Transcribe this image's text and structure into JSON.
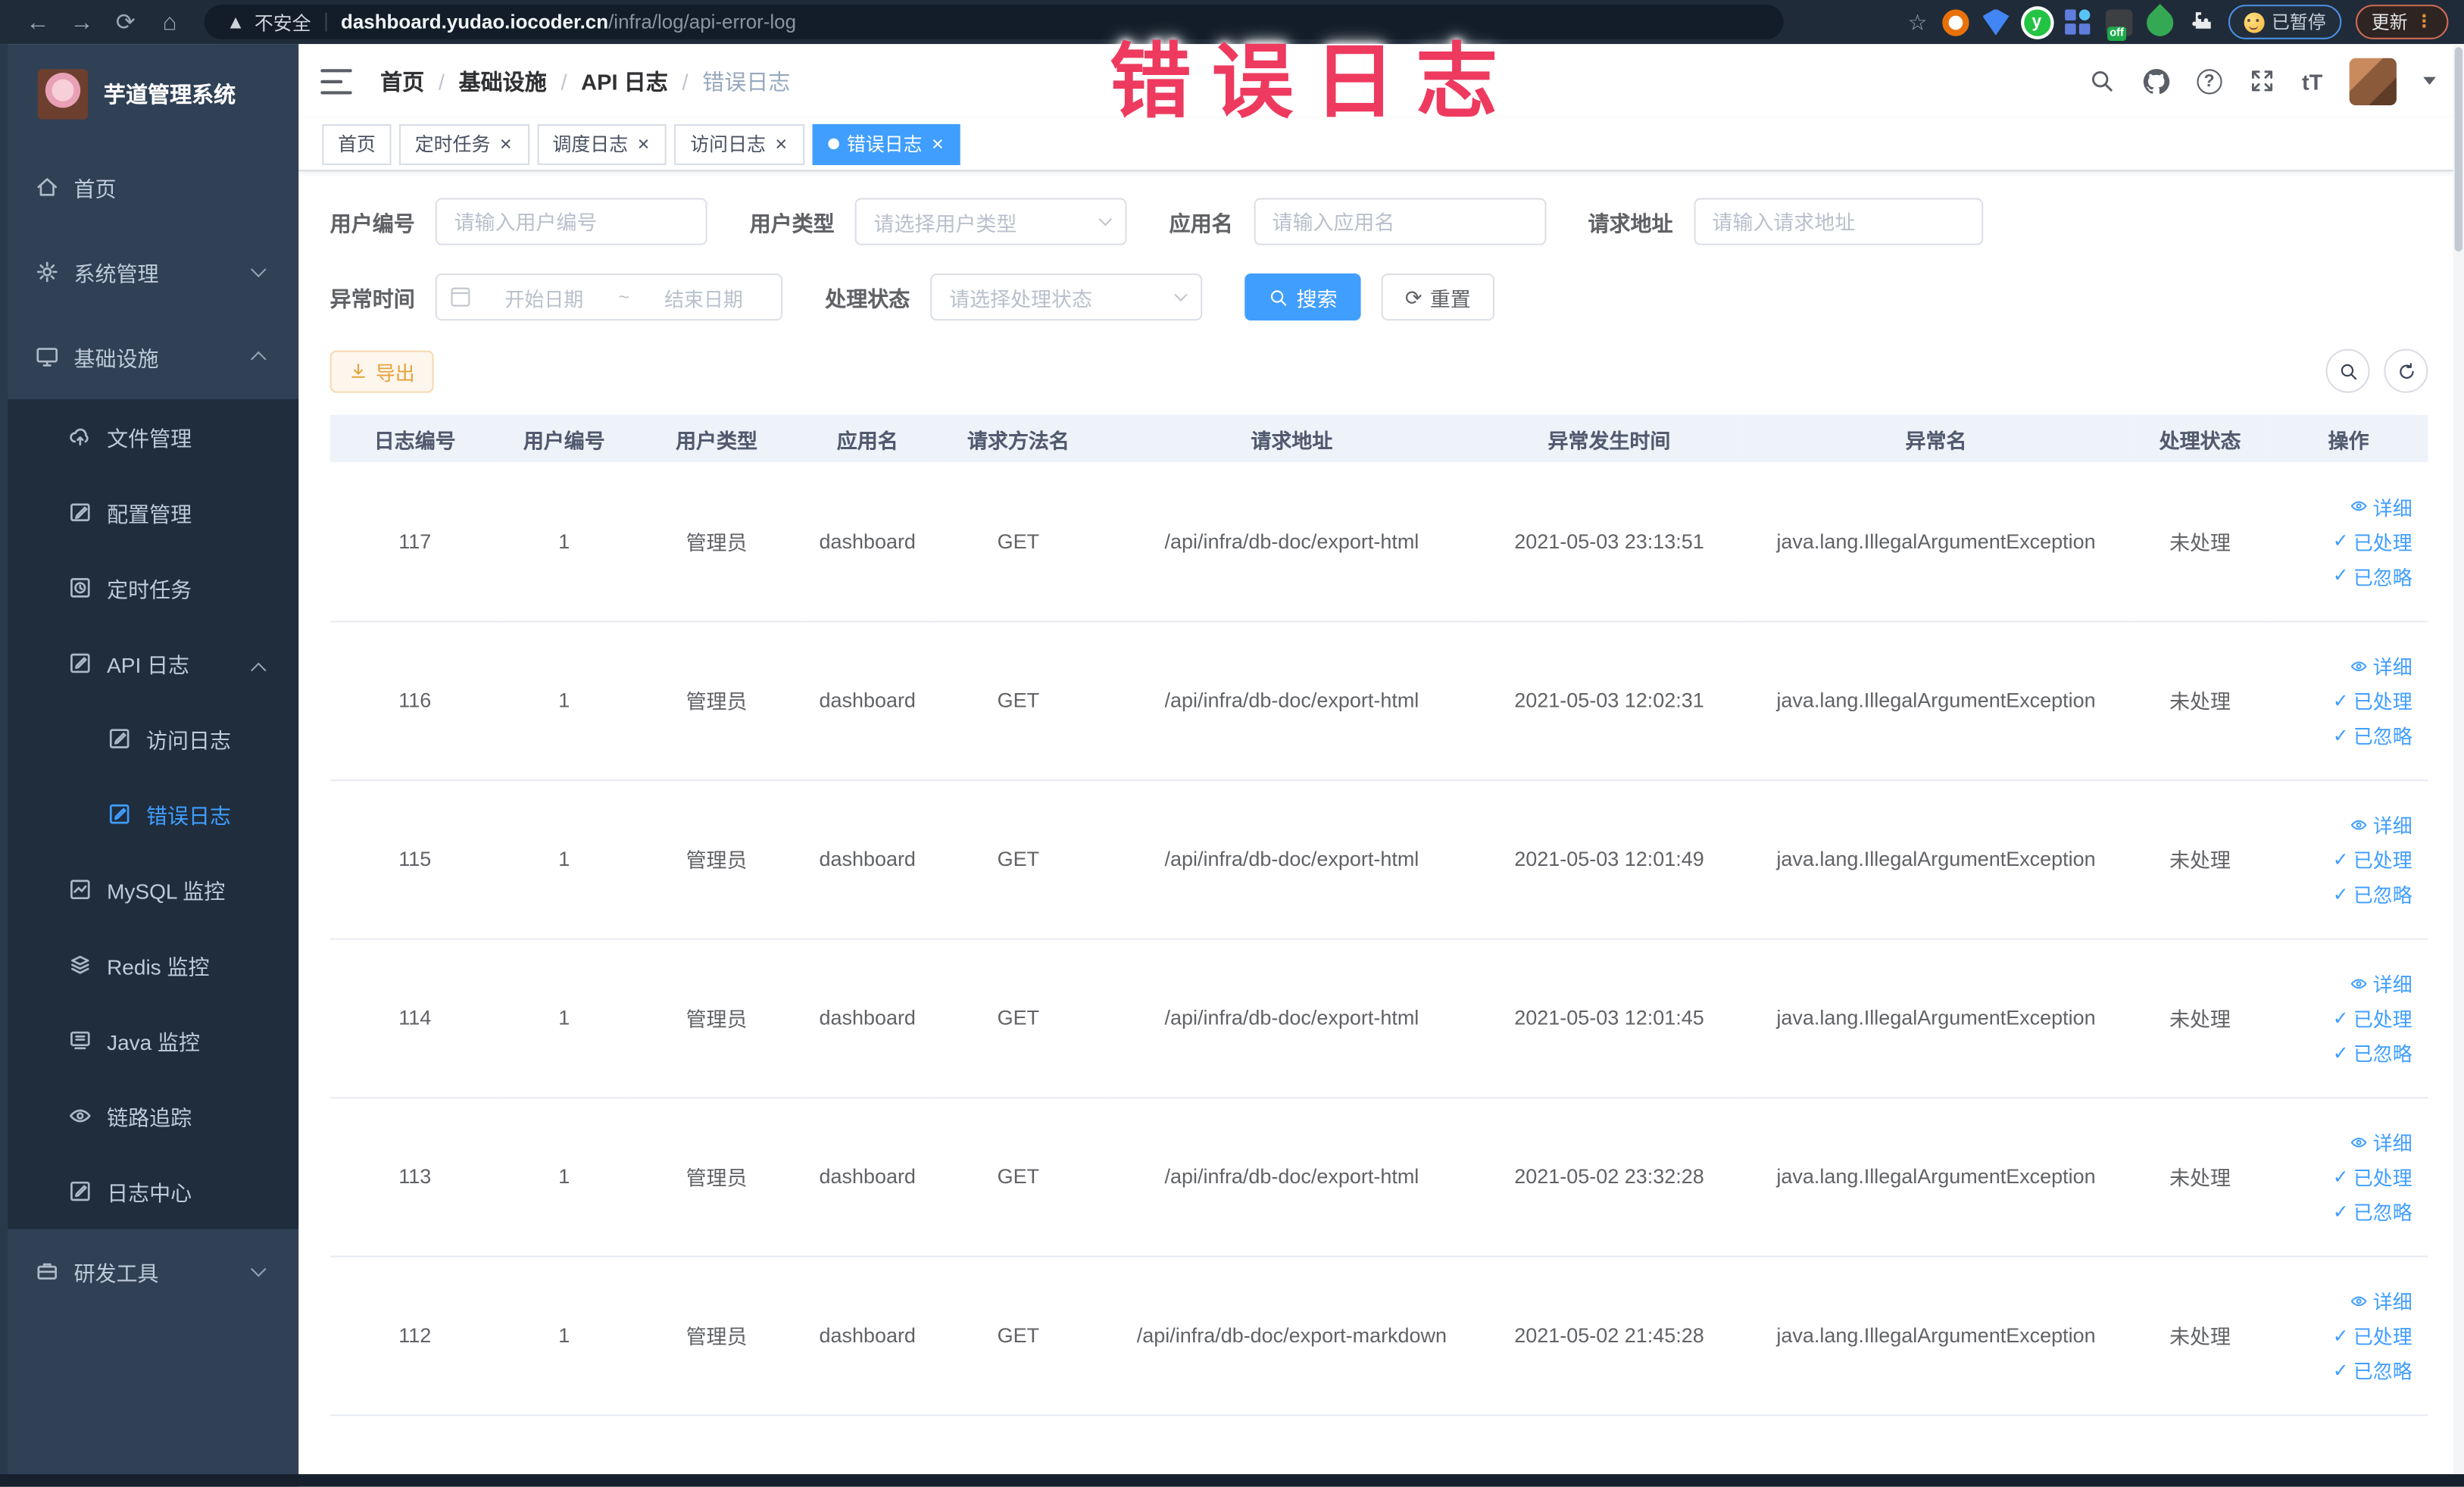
{
  "browser": {
    "security_label": "不安全",
    "url_host": "dashboard.yudao.iocoder.cn",
    "url_path": "/infra/log/api-error-log",
    "paused_badge": "已暂停",
    "update_button": "更新",
    "extension_off_badge": "off"
  },
  "watermark": "错误日志",
  "sidebar": {
    "app_title": "芋道管理系统",
    "items": [
      {
        "label": "首页",
        "level": 1
      },
      {
        "label": "系统管理",
        "level": 1,
        "chevron": "down"
      },
      {
        "label": "基础设施",
        "level": 1,
        "chevron": "up",
        "expanded": true
      },
      {
        "label": "文件管理",
        "level": 2
      },
      {
        "label": "配置管理",
        "level": 2
      },
      {
        "label": "定时任务",
        "level": 2
      },
      {
        "label": "API 日志",
        "level": 2,
        "chevron": "up",
        "expanded": true
      },
      {
        "label": "访问日志",
        "level": 3
      },
      {
        "label": "错误日志",
        "level": 3,
        "active": true
      },
      {
        "label": "MySQL 监控",
        "level": 2
      },
      {
        "label": "Redis 监控",
        "level": 2
      },
      {
        "label": "Java 监控",
        "level": 2
      },
      {
        "label": "链路追踪",
        "level": 2
      },
      {
        "label": "日志中心",
        "level": 2
      },
      {
        "label": "研发工具",
        "level": 1,
        "chevron": "down"
      }
    ]
  },
  "breadcrumb": {
    "items": [
      "首页",
      "基础设施",
      "API 日志",
      "错误日志"
    ]
  },
  "tabs": [
    {
      "label": "首页",
      "closable": false,
      "active": false
    },
    {
      "label": "定时任务",
      "closable": true,
      "active": false
    },
    {
      "label": "调度日志",
      "closable": true,
      "active": false
    },
    {
      "label": "访问日志",
      "closable": true,
      "active": false
    },
    {
      "label": "错误日志",
      "closable": true,
      "active": true
    }
  ],
  "filters": {
    "user_id": {
      "label": "用户编号",
      "placeholder": "请输入用户编号"
    },
    "user_type": {
      "label": "用户类型",
      "placeholder": "请选择用户类型"
    },
    "app_name": {
      "label": "应用名",
      "placeholder": "请输入应用名"
    },
    "request_url": {
      "label": "请求地址",
      "placeholder": "请输入请求地址"
    },
    "exception_time": {
      "label": "异常时间",
      "start_placeholder": "开始日期",
      "separator": "~",
      "end_placeholder": "结束日期"
    },
    "process_status": {
      "label": "处理状态",
      "placeholder": "请选择处理状态"
    },
    "search_button": "搜索",
    "reset_button": "重置"
  },
  "toolbar": {
    "export_button": "导出"
  },
  "table": {
    "headers": [
      "日志编号",
      "用户编号",
      "用户类型",
      "应用名",
      "请求方法名",
      "请求地址",
      "异常发生时间",
      "异常名",
      "处理状态",
      "操作"
    ],
    "actions": {
      "detail": "详细",
      "processed": "已处理",
      "ignored": "已忽略"
    },
    "rows": [
      {
        "id": "117",
        "user_id": "1",
        "user_type": "管理员",
        "app": "dashboard",
        "method": "GET",
        "url": "/api/infra/db-doc/export-html",
        "time": "2021-05-03 23:13:51",
        "exception": "java.lang.IllegalArgumentException",
        "status": "未处理"
      },
      {
        "id": "116",
        "user_id": "1",
        "user_type": "管理员",
        "app": "dashboard",
        "method": "GET",
        "url": "/api/infra/db-doc/export-html",
        "time": "2021-05-03 12:02:31",
        "exception": "java.lang.IllegalArgumentException",
        "status": "未处理"
      },
      {
        "id": "115",
        "user_id": "1",
        "user_type": "管理员",
        "app": "dashboard",
        "method": "GET",
        "url": "/api/infra/db-doc/export-html",
        "time": "2021-05-03 12:01:49",
        "exception": "java.lang.IllegalArgumentException",
        "status": "未处理"
      },
      {
        "id": "114",
        "user_id": "1",
        "user_type": "管理员",
        "app": "dashboard",
        "method": "GET",
        "url": "/api/infra/db-doc/export-html",
        "time": "2021-05-03 12:01:45",
        "exception": "java.lang.IllegalArgumentException",
        "status": "未处理"
      },
      {
        "id": "113",
        "user_id": "1",
        "user_type": "管理员",
        "app": "dashboard",
        "method": "GET",
        "url": "/api/infra/db-doc/export-html",
        "time": "2021-05-02 23:32:28",
        "exception": "java.lang.IllegalArgumentException",
        "status": "未处理"
      },
      {
        "id": "112",
        "user_id": "1",
        "user_type": "管理员",
        "app": "dashboard",
        "method": "GET",
        "url": "/api/infra/db-doc/export-markdown",
        "time": "2021-05-02 21:45:28",
        "exception": "java.lang.IllegalArgumentException",
        "status": "未处理"
      }
    ]
  },
  "colors": {
    "primary": "#409eff",
    "warning": "#e6a23c",
    "watermark_red": "#ee3a5f",
    "sidebar_bg": "#304156",
    "submenu_bg": "#1f2d3d"
  }
}
